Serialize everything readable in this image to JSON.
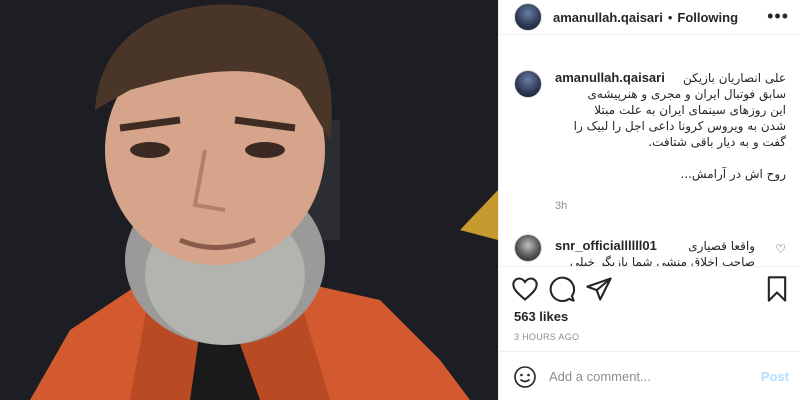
{
  "post": {
    "photo_alt": "portrait",
    "colors": {
      "jacket": "#d35a2e",
      "background": "#1c1e23",
      "link_disabled": "#b2dffc",
      "muted": "#8e8e8e"
    }
  },
  "header": {
    "username": "amanullah.qaisari",
    "separator": "•",
    "follow_label": "Following",
    "more_icon": "more-horizontal-icon"
  },
  "caption": {
    "username": "amanullah.qaisari",
    "text": "علی انصاریان بازیکن\nسابق فوتبال ایران و مجری و هنرپیشه‌ی\nاین روزهای سینمای ایران به علت مبتلا\nشدن به ویروس کرونا داعی اجل را لبیک را\nگفت و به دیار باقی شتافت.\n\nروح اش در آرامش...",
    "time": "3h"
  },
  "reply": {
    "username": "snr_officiallllll01",
    "text": "واقعا قصیاری\nصاحب اخلاق منشی شما بازیگر خیلی"
  },
  "actions": {
    "icons": [
      "heart-icon",
      "comment-icon",
      "share-icon",
      "bookmark-icon"
    ],
    "likes": "563 likes",
    "time_ago": "3 HOURS AGO"
  },
  "comment_box": {
    "placeholder": "Add a comment...",
    "post_label": "Post",
    "emoji_icon": "smiley-icon"
  }
}
